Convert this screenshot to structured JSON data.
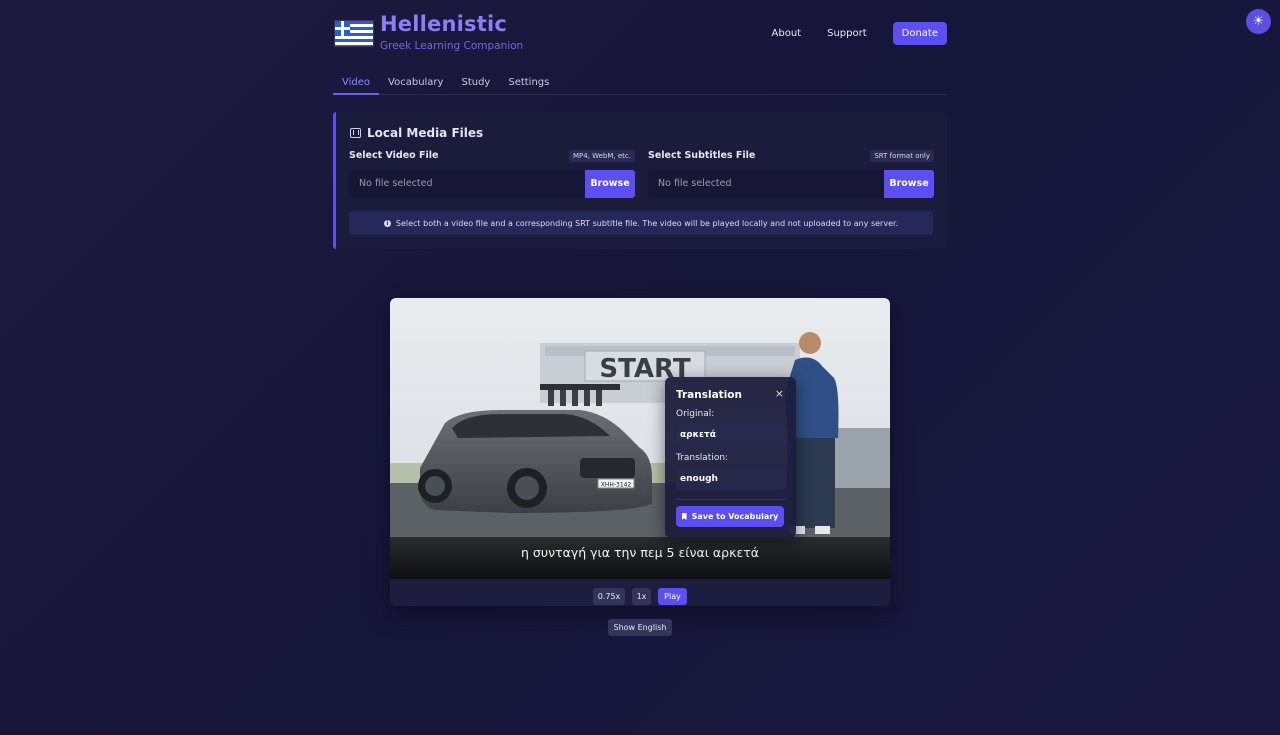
{
  "app": {
    "title": "Hellenistic",
    "subtitle": "Greek Learning Companion"
  },
  "nav": {
    "about": "About",
    "support": "Support",
    "donate": "Donate"
  },
  "tabs": [
    {
      "label": "Video",
      "active": true
    },
    {
      "label": "Vocabulary",
      "active": false
    },
    {
      "label": "Study",
      "active": false
    },
    {
      "label": "Settings",
      "active": false
    }
  ],
  "media_panel": {
    "title": "Local Media Files",
    "video_field": {
      "label": "Select Video File",
      "badge": "MP4, WebM, etc.",
      "value": "No file selected",
      "button": "Browse"
    },
    "subtitle_field": {
      "label": "Select Subtitles File",
      "badge": "SRT format only",
      "value": "No file selected",
      "button": "Browse"
    },
    "info": "Select both a video file and a corresponding SRT subtitle file. The video will be played locally and not uploaded to any server."
  },
  "player": {
    "subtitle_text": "η συνταγή για την πεμ 5 είναι αρκετά",
    "sign_text": "START",
    "plate_text": "ΧΗΗ-3142",
    "controls": {
      "slow": "0.75x",
      "normal": "1x",
      "play": "Play",
      "show_english": "Show English"
    }
  },
  "translation_popup": {
    "title": "Translation",
    "close": "×",
    "original_label": "Original:",
    "original_value": "αρκετά",
    "translation_label": "Translation:",
    "translation_value": "enough",
    "save_button": "Save to Vocabulary"
  },
  "colors": {
    "accent": "#5b4ff0",
    "brand": "#8f7cf6",
    "background": "#1b1a3d"
  }
}
